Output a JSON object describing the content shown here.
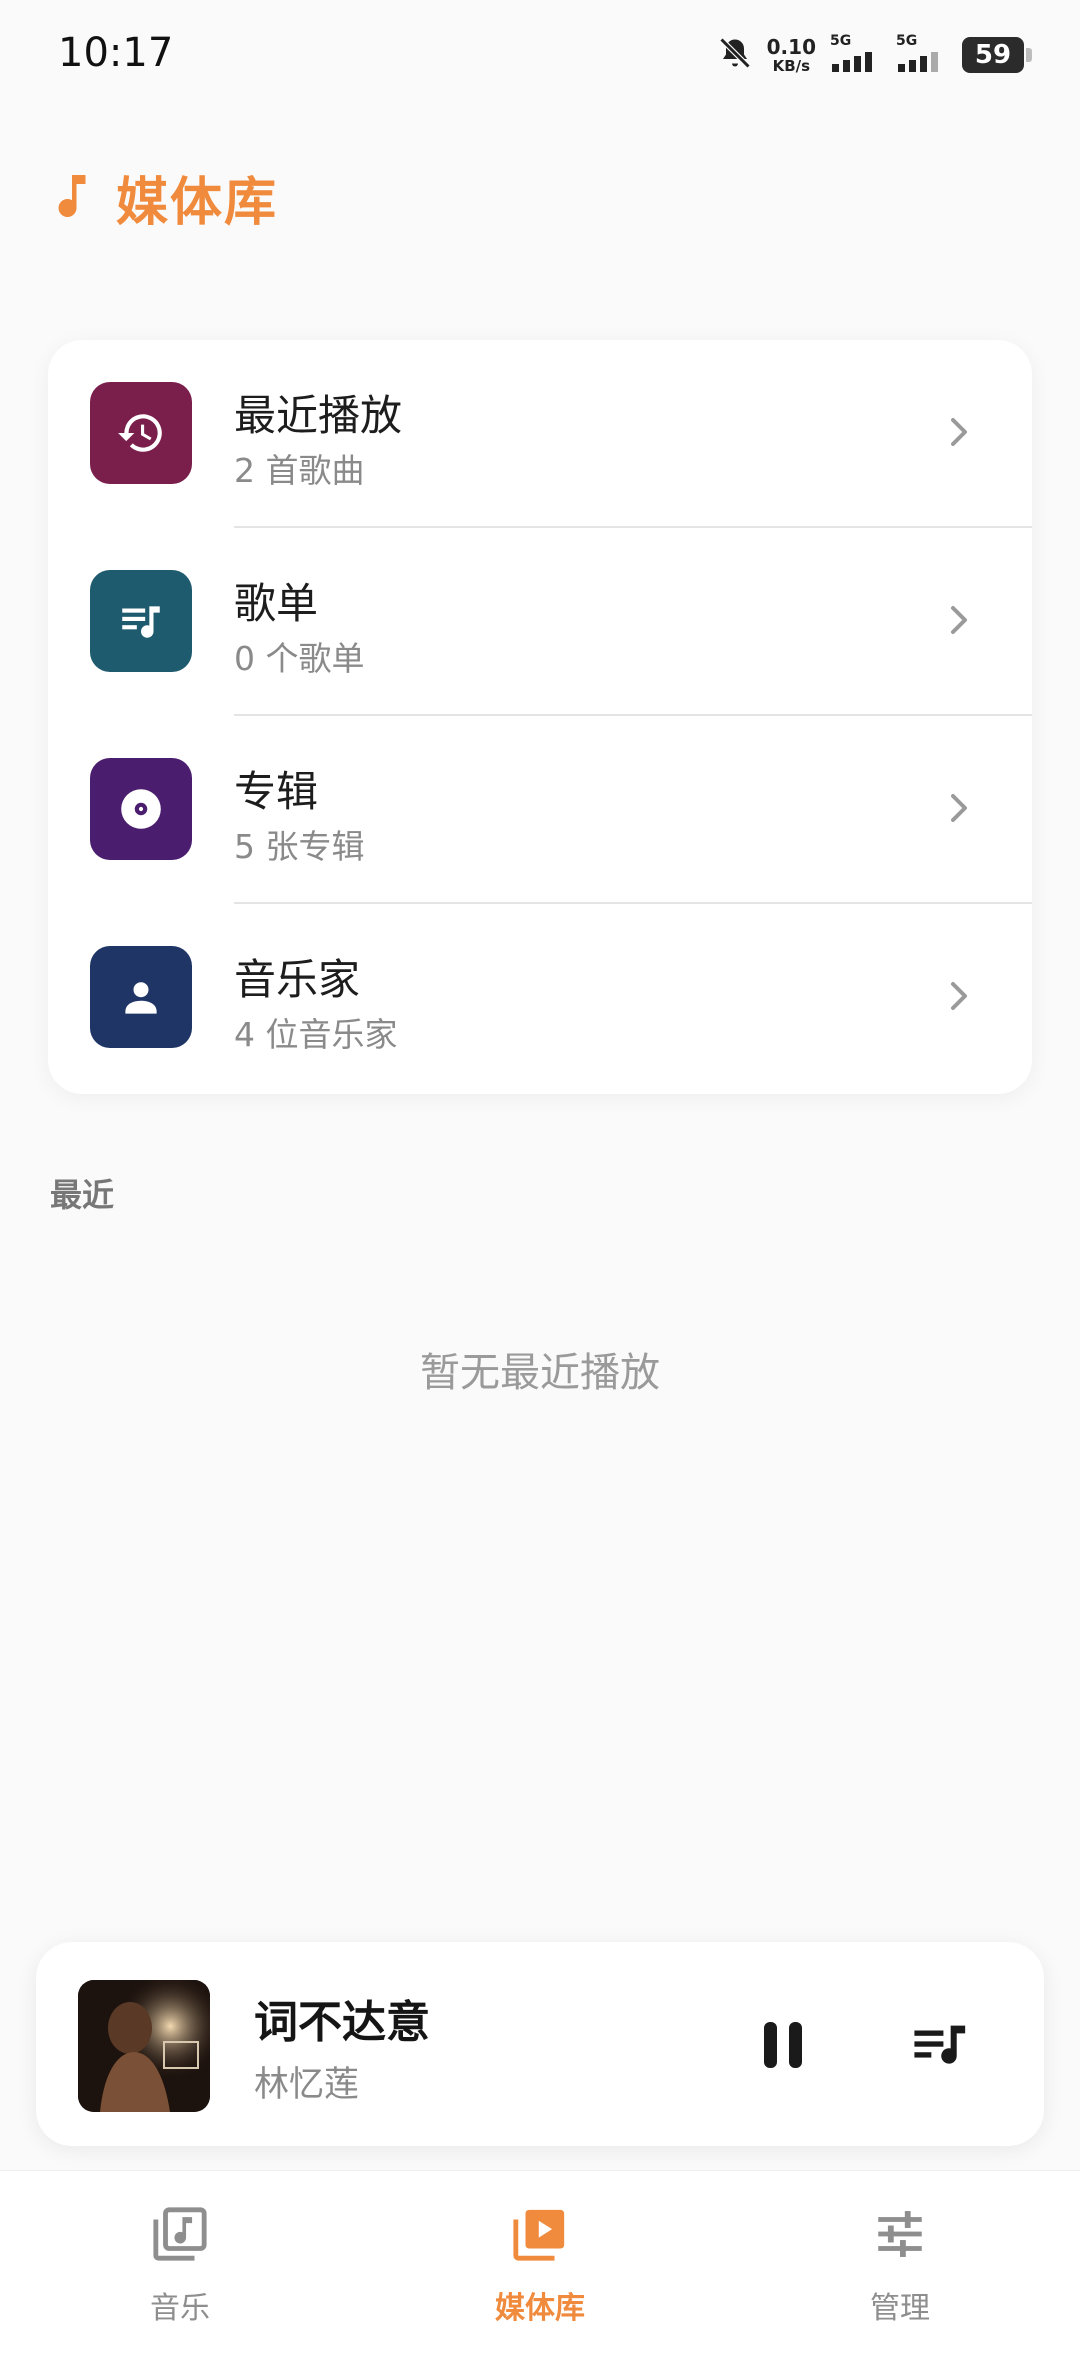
{
  "status_bar": {
    "time": "10:17",
    "net_speed_value": "0.10",
    "net_speed_unit": "KB/s",
    "sim1_label": "5G",
    "sim2_label": "5G",
    "battery": "59",
    "icons": [
      "bell-off-icon",
      "signal-icon",
      "battery-icon"
    ]
  },
  "header": {
    "title": "媒体库",
    "icon": "music-note-icon",
    "accent_color": "#f08a3c"
  },
  "library": {
    "items": [
      {
        "title": "最近播放",
        "subtitle": "2 首歌曲",
        "icon": "history-icon",
        "color": "#7a1f4b"
      },
      {
        "title": "歌单",
        "subtitle": "0 个歌单",
        "icon": "playlist-icon",
        "color": "#1e5b6e"
      },
      {
        "title": "专辑",
        "subtitle": "5 张专辑",
        "icon": "album-disc-icon",
        "color": "#4a1d6e"
      },
      {
        "title": "音乐家",
        "subtitle": "4 位音乐家",
        "icon": "person-icon",
        "color": "#1f3566"
      }
    ]
  },
  "recent": {
    "label": "最近",
    "empty_message": "暂无最近播放"
  },
  "now_playing": {
    "title": "词不达意",
    "artist": "林忆莲"
  },
  "bottom_nav": {
    "items": [
      {
        "label": "音乐",
        "icon": "music-library-icon",
        "active": false
      },
      {
        "label": "媒体库",
        "icon": "media-library-icon",
        "active": true
      },
      {
        "label": "管理",
        "icon": "sliders-icon",
        "active": false
      }
    ]
  }
}
